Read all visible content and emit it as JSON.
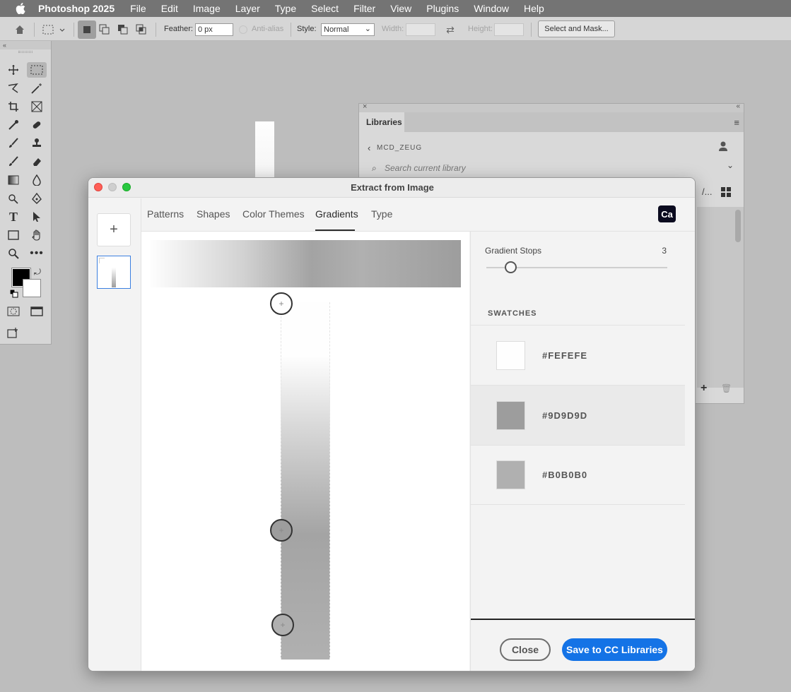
{
  "menubar": {
    "app_name": "Photoshop 2025",
    "items": [
      "File",
      "Edit",
      "Image",
      "Layer",
      "Type",
      "Select",
      "Filter",
      "View",
      "Plugins",
      "Window",
      "Help"
    ]
  },
  "options_bar": {
    "feather_label": "Feather:",
    "feather_value": "0 px",
    "antialias_label": "Anti-alias",
    "style_label": "Style:",
    "style_value": "Normal",
    "width_label": "Width:",
    "height_label": "Height:",
    "select_mask_label": "Select and Mask..."
  },
  "libraries": {
    "tab_label": "Libraries",
    "library_name": "MCD_ZEUG",
    "search_placeholder": "Search current library"
  },
  "dialog": {
    "title": "Extract from Image",
    "tabs": [
      "Patterns",
      "Shapes",
      "Color Themes",
      "Gradients",
      "Type"
    ],
    "active_tab": "Gradients",
    "ca_badge": "Ca",
    "gradient_stops_label": "Gradient Stops",
    "gradient_stops_value": "3",
    "gradient_stops_slider": {
      "min": 2,
      "max": 16,
      "value": 3
    },
    "swatches_header": "SWATCHES",
    "swatches": [
      {
        "hex": "#FEFEFE",
        "color": "#fefefe"
      },
      {
        "hex": "#9D9D9D",
        "color": "#9d9d9d"
      },
      {
        "hex": "#B0B0B0",
        "color": "#b0b0b0"
      }
    ],
    "selected_swatch": 1,
    "close_label": "Close",
    "save_label": "Save to CC Libraries"
  }
}
